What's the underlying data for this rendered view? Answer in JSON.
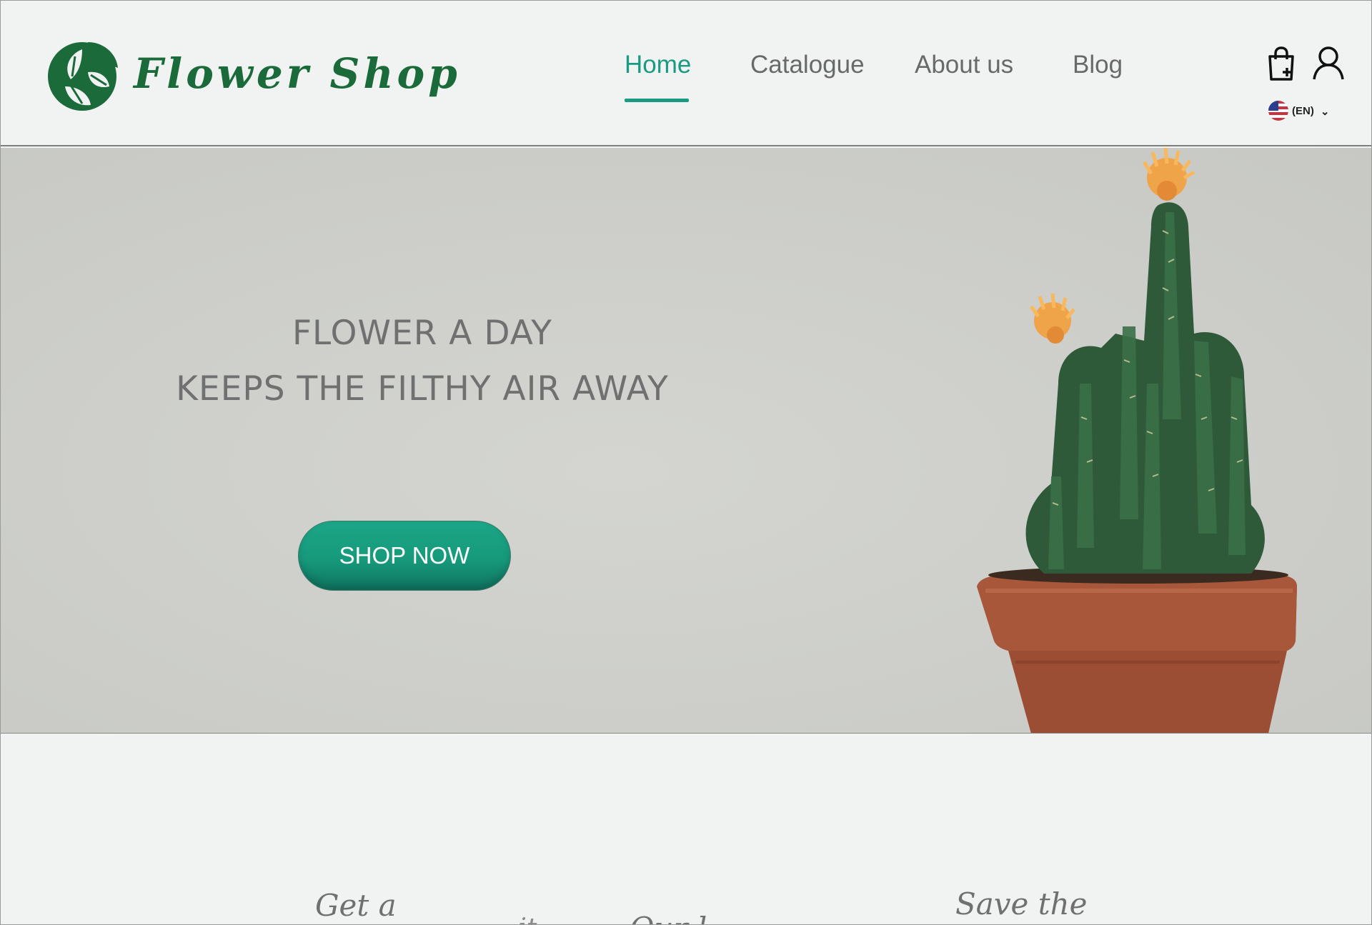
{
  "brand": {
    "name": "Flower Shop",
    "color": "#1a6a3a"
  },
  "nav": {
    "items": [
      {
        "label": "Home",
        "active": true
      },
      {
        "label": "Catalogue",
        "active": false
      },
      {
        "label": "About us",
        "active": false
      },
      {
        "label": "Blog",
        "active": false
      }
    ],
    "active_color": "#1a9a80"
  },
  "header_icons": {
    "cart": "shopping-bag-icon",
    "account": "user-icon"
  },
  "language": {
    "flag": "us-flag-icon",
    "label": "(EN)"
  },
  "hero": {
    "tagline_line1": "FLOWER A DAY",
    "tagline_line2": "KEEPS THE FILTHY AIR AWAY",
    "cta_label": "SHOP NOW",
    "cta_color": "#179a7c",
    "image": "potted-cactus-photo"
  },
  "features": [
    {
      "title": "Get a"
    },
    {
      "title": "Our l...",
      "aside": "...it..."
    },
    {
      "title": "Save the"
    }
  ]
}
